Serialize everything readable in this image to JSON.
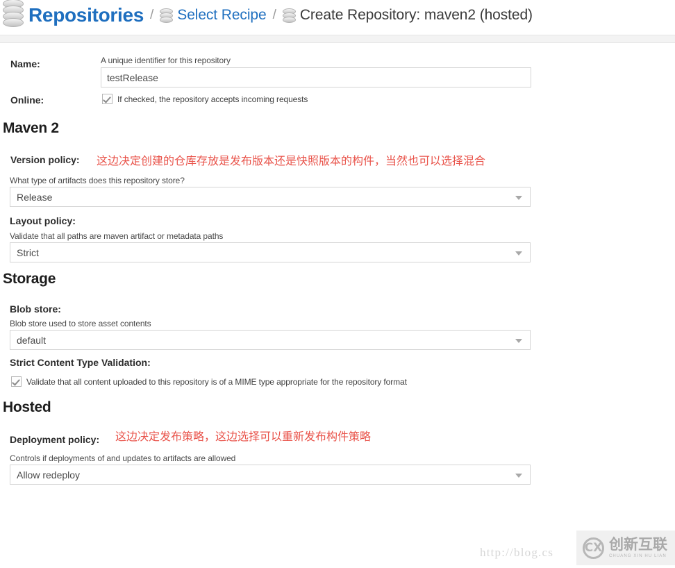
{
  "breadcrumb": {
    "root_icon": "database-icon",
    "root_label": "Repositories",
    "separator": "/",
    "recipe_icon": "database-icon",
    "recipe_label": "Select Recipe",
    "current_icon": "database-icon",
    "current_label": "Create Repository: maven2 (hosted)"
  },
  "form": {
    "name": {
      "label": "Name:",
      "help": "A unique identifier for this repository",
      "value": "testRelease",
      "placeholder": ""
    },
    "online": {
      "label": "Online:",
      "checkbox_label": "If checked, the repository accepts incoming requests",
      "checked": true
    }
  },
  "maven2": {
    "section_title": "Maven 2",
    "version_policy": {
      "label": "Version policy:",
      "annotation": "这边决定创建的仓库存放是发布版本还是快照版本的构件，当然也可以选择混合",
      "help": "What type of artifacts does this repository store?",
      "value": "Release"
    },
    "layout_policy": {
      "label": "Layout policy:",
      "help": "Validate that all paths are maven artifact or metadata paths",
      "value": "Strict"
    }
  },
  "storage": {
    "section_title": "Storage",
    "blob_store": {
      "label": "Blob store:",
      "help": "Blob store used to store asset contents",
      "value": "default"
    },
    "strict_content_type": {
      "label": "Strict Content Type Validation:",
      "checkbox_label": "Validate that all content uploaded to this repository is of a MIME type appropriate for the repository format",
      "checked": true
    }
  },
  "hosted": {
    "section_title": "Hosted",
    "deployment_policy": {
      "label": "Deployment policy:",
      "annotation": "这边决定发布策略，这边选择可以重新发布构件策略",
      "help": "Controls if deployments of and updates to artifacts are allowed",
      "value": "Allow redeploy"
    }
  },
  "watermark": {
    "url": "http://blog.cs",
    "logo_mark": "CX",
    "brand_cn": "创新互联",
    "brand_pinyin": "CHUANG XIN HU LIAN"
  },
  "colors": {
    "link_blue": "#1f6fbf",
    "annotation_red": "#e9544b",
    "text_dark": "#2c2c2c",
    "border_gray": "#d4d4d4"
  }
}
